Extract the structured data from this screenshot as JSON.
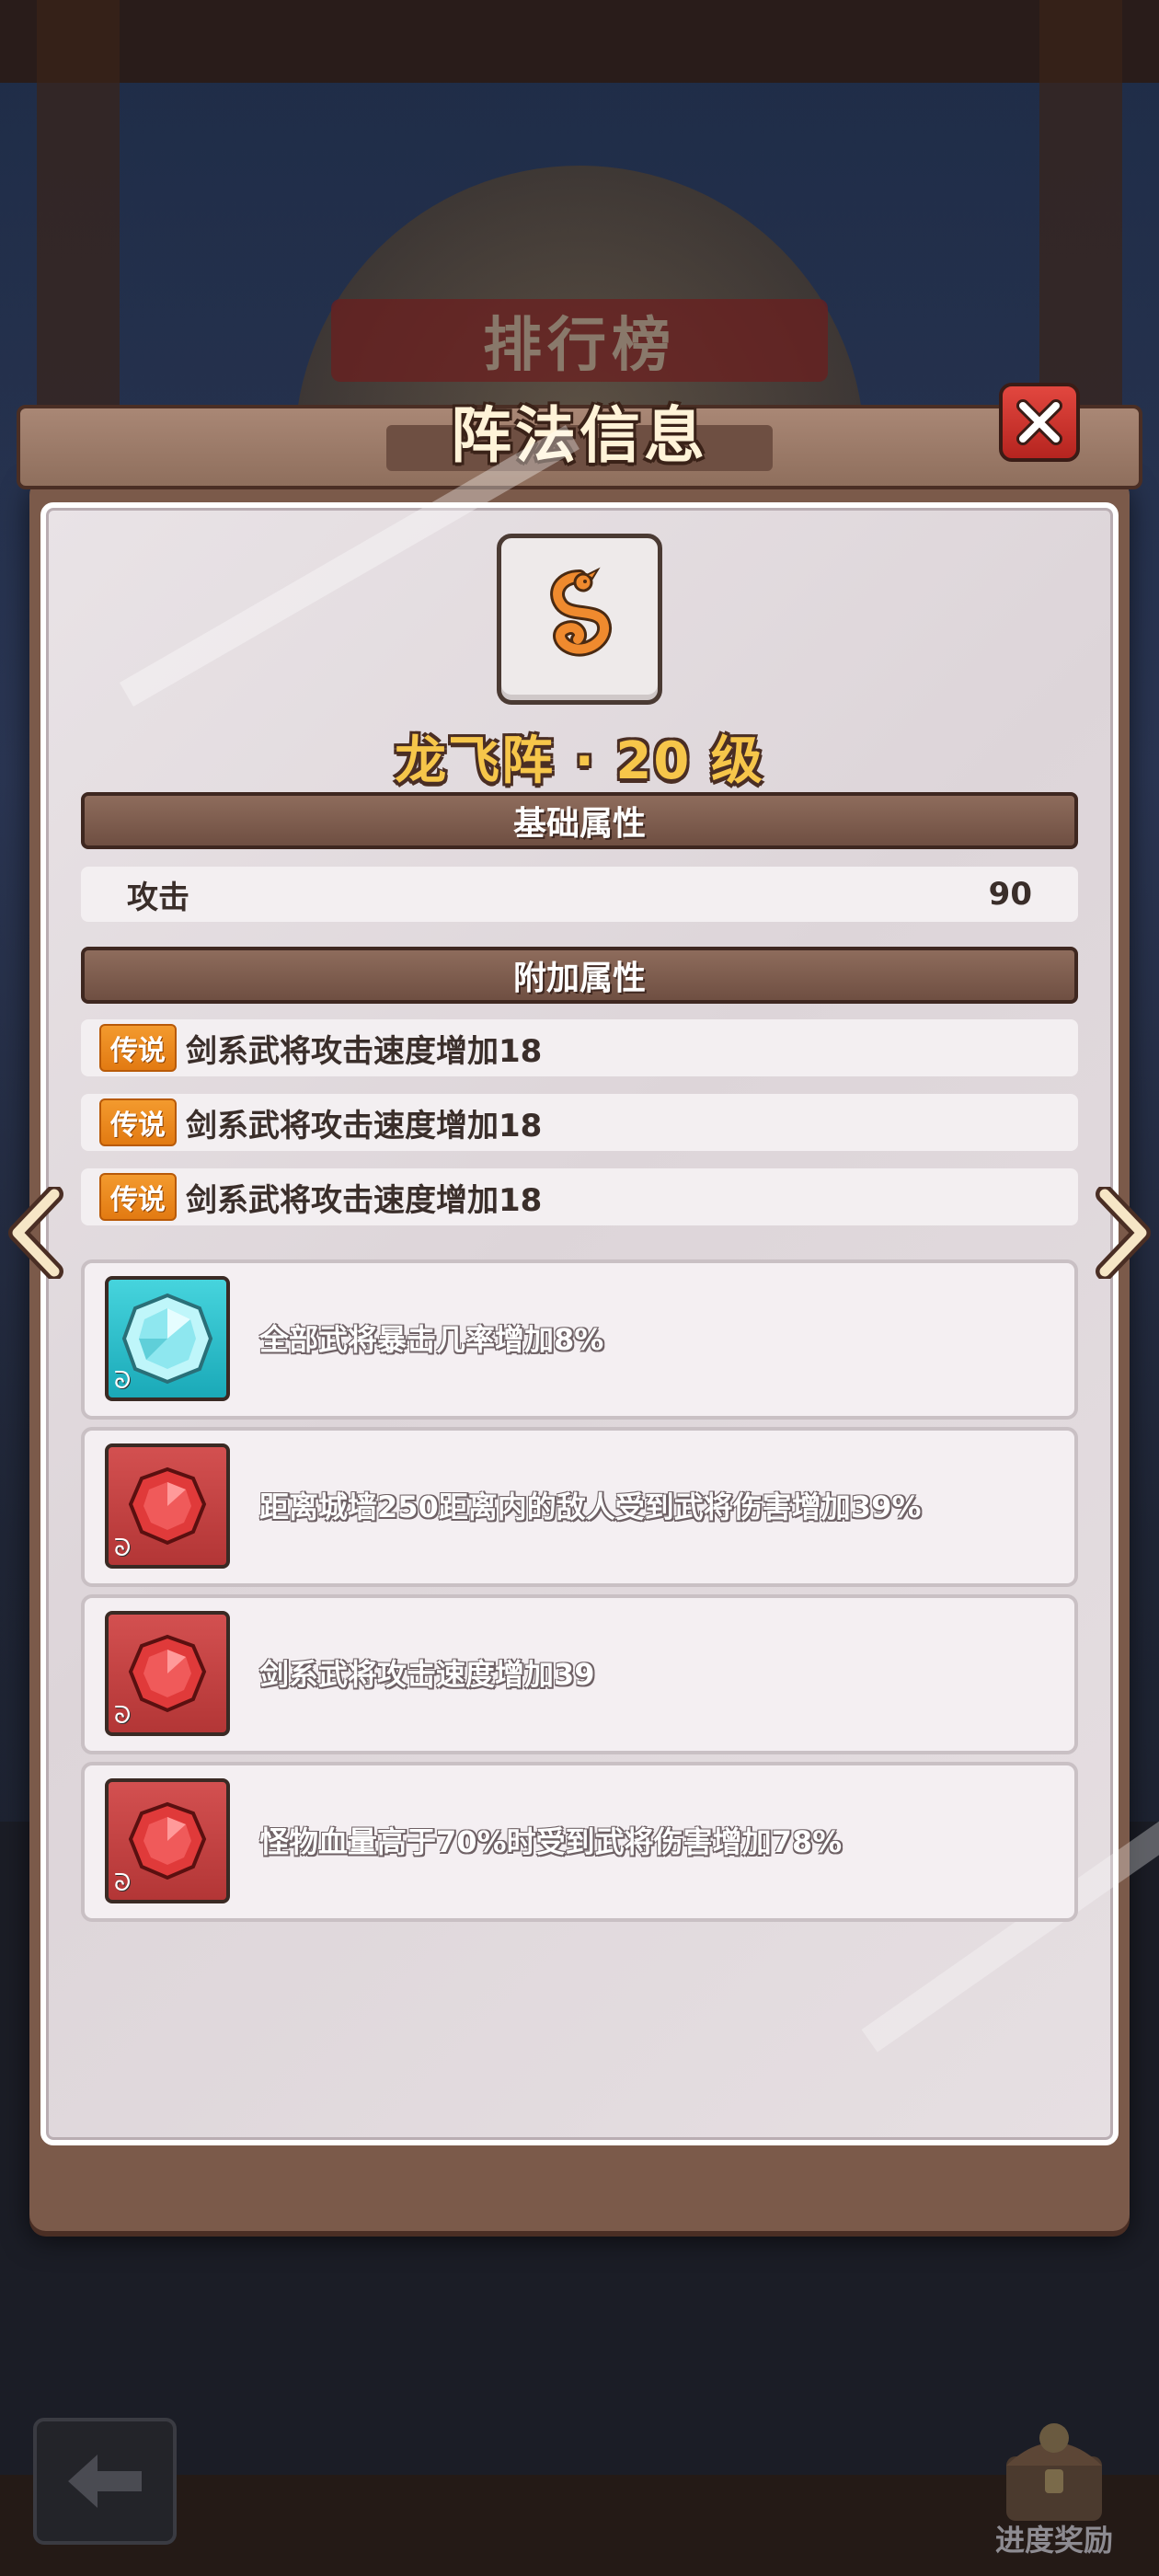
{
  "background": {
    "banner_text": "排行榜"
  },
  "modal": {
    "title": "阵法信息",
    "close_icon": "close-icon"
  },
  "formation": {
    "icon": "dragon-icon",
    "name": "龙飞阵 · 20 级"
  },
  "base_attributes": {
    "header": "基础属性",
    "rows": [
      {
        "label": "攻击",
        "value": "90"
      }
    ]
  },
  "extra_attributes": {
    "header": "附加属性",
    "rows": [
      {
        "tag": "传说",
        "text": "剑系武将攻击速度增加18"
      },
      {
        "tag": "传说",
        "text": "剑系武将攻击速度增加18"
      },
      {
        "tag": "传说",
        "text": "剑系武将攻击速度增加18"
      }
    ]
  },
  "gems": [
    {
      "color": "cyan",
      "icon": "diamond-gem-icon",
      "text": "全部武将暴击几率增加8%"
    },
    {
      "color": "red",
      "icon": "ruby-gem-icon",
      "text": "距离城墙250距离内的敌人受到武将伤害增加39%"
    },
    {
      "color": "red",
      "icon": "ruby-gem-icon",
      "text": "剑系武将攻击速度增加39"
    },
    {
      "color": "red",
      "icon": "ruby-gem-icon",
      "text": "怪物血量高于70%时受到武将伤害增加78%"
    }
  ],
  "bottom": {
    "progress_reward_label": "进度奖励"
  },
  "colors": {
    "accent_gold": "#f6c64a",
    "frame_brown": "#7b5a4a",
    "close_red": "#d13a33",
    "rarity_orange": "#e27a12"
  }
}
